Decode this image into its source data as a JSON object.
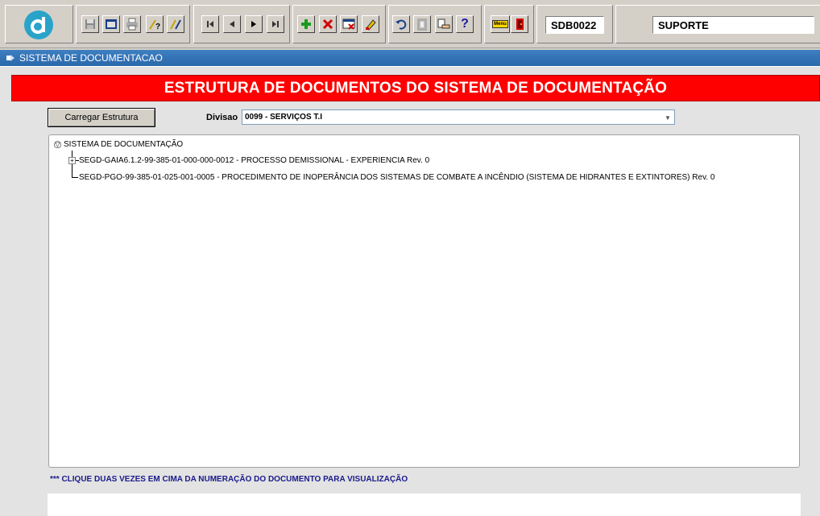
{
  "toolbar": {
    "form_code": "SDB0022",
    "user": "SUPORTE",
    "buttons": [
      {
        "name": "save-icon"
      },
      {
        "name": "window-icon"
      },
      {
        "name": "print-icon"
      },
      {
        "name": "query-icon"
      },
      {
        "name": "execute-query-icon"
      },
      {
        "name": "first-record-icon"
      },
      {
        "name": "previous-record-icon"
      },
      {
        "name": "next-record-icon"
      },
      {
        "name": "last-record-icon"
      },
      {
        "name": "add-record-icon"
      },
      {
        "name": "delete-record-icon"
      },
      {
        "name": "clear-record-icon"
      },
      {
        "name": "edit-icon"
      },
      {
        "name": "undo-icon"
      },
      {
        "name": "clipboard-icon"
      },
      {
        "name": "point-hand-icon"
      },
      {
        "name": "help-icon"
      },
      {
        "name": "menu-icon"
      },
      {
        "name": "exit-icon"
      }
    ],
    "help_glyph": "?",
    "menu_glyph": "Menu"
  },
  "window": {
    "title": "SISTEMA DE DOCUMENTACAO"
  },
  "main": {
    "banner": "ESTRUTURA DE DOCUMENTOS DO SISTEMA DE DOCUMENTAÇÃO",
    "load_button": "Carregar Estrutura",
    "division_label": "Divisao",
    "division_value": "0099 - SERVIÇOS T.I",
    "tree": {
      "root": "SISTEMA DE DOCUMENTAÇÃO",
      "children": [
        "SEGD-GAIA6.1.2-99-385-01-000-000-0012 - PROCESSO DEMISSIONAL - EXPERIENCIA Rev. 0",
        "SEGD-PGO-99-385-01-025-001-0005 - PROCEDIMENTO DE INOPERÂNCIA DOS SISTEMAS DE COMBATE A INCÊNDIO (SISTEMA DE HIDRANTES E EXTINTORES) Rev. 0"
      ]
    },
    "hint": "*** CLIQUE DUAS VEZES EM CIMA DA NUMERAÇÃO DO DOCUMENTO PARA VISUALIZAÇÃO"
  },
  "colors": {
    "banner": "#ff0000",
    "titlebar": "#2a68aa",
    "logo": "#2aa3c9",
    "hint": "#1a1a8c"
  }
}
